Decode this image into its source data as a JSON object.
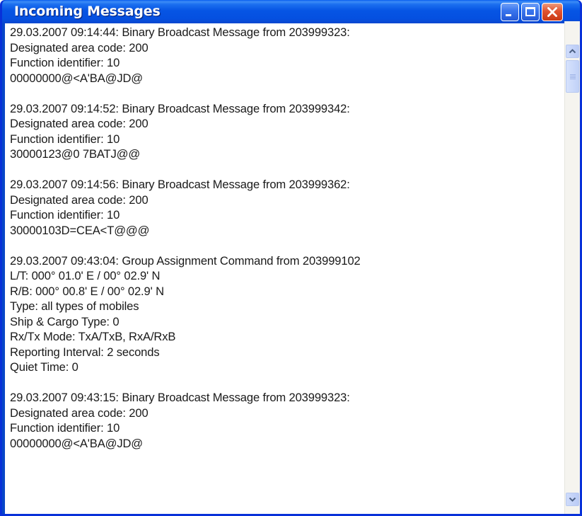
{
  "window": {
    "title": "Incoming Messages",
    "controls": [
      "minimize",
      "maximize",
      "close"
    ]
  },
  "messages": [
    {
      "lines": [
        "29.03.2007 09:14:44: Binary Broadcast Message from 203999323:",
        "Designated area code: 200",
        "Function identifier: 10",
        "00000000@<A'BA@JD@"
      ]
    },
    {
      "lines": [
        "29.03.2007 09:14:52: Binary Broadcast Message from 203999342:",
        "Designated area code: 200",
        "Function identifier: 10",
        "30000123@0 7BATJ@@"
      ]
    },
    {
      "lines": [
        "29.03.2007 09:14:56: Binary Broadcast Message from 203999362:",
        "Designated area code: 200",
        "Function identifier: 10",
        "30000103D=CEA<T@@@"
      ]
    },
    {
      "lines": [
        "29.03.2007 09:43:04: Group Assignment Command from 203999102",
        "L/T: 000° 01.0' E / 00° 02.9' N",
        "R/B: 000° 00.8' E / 00° 02.9' N",
        "Type: all types of mobiles",
        "Ship & Cargo Type: 0",
        "Rx/Tx Mode: TxA/TxB, RxA/RxB",
        "Reporting Interval: 2 seconds",
        "Quiet Time: 0"
      ]
    },
    {
      "lines": [
        "29.03.2007 09:43:15: Binary Broadcast Message from 203999323:",
        "Designated area code: 200",
        "Function identifier: 10",
        "00000000@<A'BA@JD@"
      ]
    }
  ],
  "icons": {
    "minimize": "minimize-icon",
    "maximize": "maximize-icon",
    "close": "close-icon",
    "scroll_up": "chevron-up-icon",
    "scroll_down": "chevron-down-icon"
  },
  "colors": {
    "titlebar": "#0655e4",
    "close_button": "#e0522f",
    "scrollbar_thumb": "#c1d1f8"
  }
}
